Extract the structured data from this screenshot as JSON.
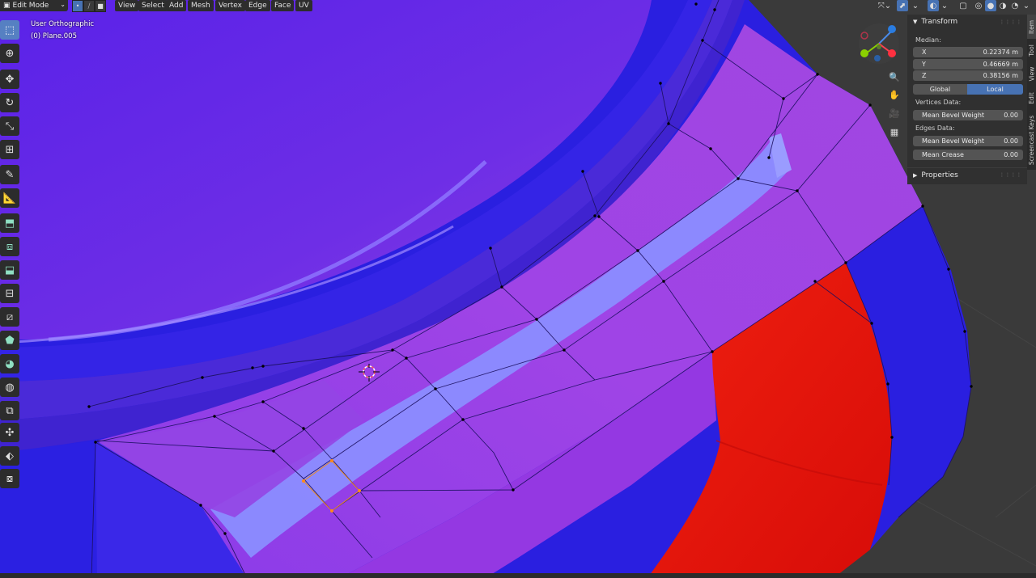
{
  "header": {
    "mode": "Edit Mode",
    "menus": [
      "View",
      "Select",
      "Add",
      "Mesh",
      "Vertex",
      "Edge",
      "Face",
      "UV"
    ]
  },
  "viewport": {
    "view_name": "User Orthographic",
    "object_name": "(0) Plane.005"
  },
  "gizmo": {
    "axes": [
      "X",
      "Y",
      "Z"
    ]
  },
  "sidebar": {
    "tabs": [
      "Item",
      "Tool",
      "View",
      "Edit",
      "Screencast Keys"
    ],
    "transform": {
      "title": "Transform",
      "median_label": "Median:",
      "x_label": "X",
      "x_value": "0.22374 m",
      "y_label": "Y",
      "y_value": "0.46669 m",
      "z_label": "Z",
      "z_value": "0.38156 m",
      "global_label": "Global",
      "local_label": "Local",
      "vertices_data_label": "Vertices Data:",
      "vert_bevel_label": "Mean Bevel Weight",
      "vert_bevel_value": "0.00",
      "edges_data_label": "Edges Data:",
      "edge_bevel_label": "Mean Bevel Weight",
      "edge_bevel_value": "0.00",
      "crease_label": "Mean Crease",
      "crease_value": "0.00"
    },
    "properties": {
      "title": "Properties"
    }
  },
  "colors": {
    "accent": "#4772b3",
    "mesh_blue": "#2a1fe0",
    "mesh_purple": "#9b3de6",
    "mesh_red": "#e8180e",
    "highlight": "#8a8cff"
  }
}
